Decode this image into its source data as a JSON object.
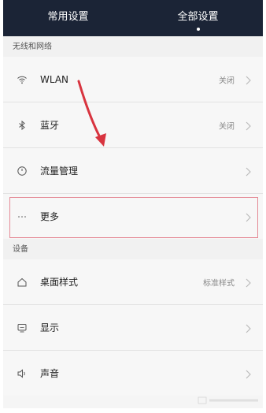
{
  "topbar": {
    "tabs": [
      {
        "label": "常用设置",
        "active": false
      },
      {
        "label": "全部设置",
        "active": true
      }
    ]
  },
  "sections": {
    "wireless": {
      "header": "无线和网络",
      "items": [
        {
          "label": "WLAN",
          "value": "关闭",
          "icon": "wifi-icon"
        },
        {
          "label": "蓝牙",
          "value": "关闭",
          "icon": "bluetooth-icon"
        },
        {
          "label": "流量管理",
          "value": "",
          "icon": "data-usage-icon"
        },
        {
          "label": "更多",
          "value": "",
          "icon": "more-icon"
        }
      ]
    },
    "device": {
      "header": "设备",
      "items": [
        {
          "label": "桌面样式",
          "value": "标准样式",
          "icon": "home-icon"
        },
        {
          "label": "显示",
          "value": "",
          "icon": "display-icon"
        },
        {
          "label": "声音",
          "value": "",
          "icon": "speaker-icon"
        }
      ]
    }
  },
  "colors": {
    "topbar": "#1b2436",
    "highlight_border": "#e58a96",
    "annotation_arrow": "#d8343f"
  }
}
